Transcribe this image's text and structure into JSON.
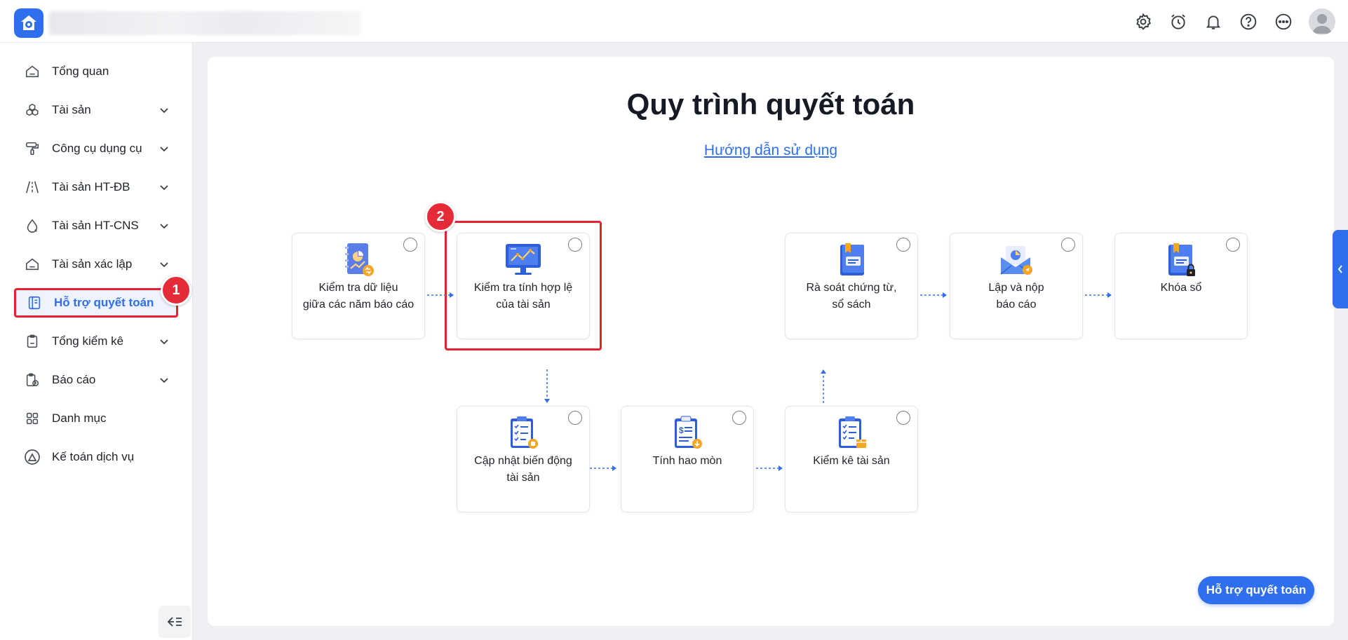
{
  "header": {
    "icons": [
      "settings-icon",
      "alarm-clock-icon",
      "bell-icon",
      "help-icon",
      "more-icon",
      "user-avatar"
    ]
  },
  "sidebar": {
    "items": [
      {
        "label": "Tổng quan",
        "icon": "home-icon",
        "has_children": false
      },
      {
        "label": "Tài sản",
        "icon": "cubes-icon",
        "has_children": true
      },
      {
        "label": "Công cụ dụng cụ",
        "icon": "paint-roller-icon",
        "has_children": true
      },
      {
        "label": "Tài sản HT-ĐB",
        "icon": "road-icon",
        "has_children": true
      },
      {
        "label": "Tài sản HT-CNS",
        "icon": "water-drop-icon",
        "has_children": true
      },
      {
        "label": "Tài sản xác lập",
        "icon": "home-icon",
        "has_children": true
      },
      {
        "label": "Hỗ trợ quyết toán",
        "icon": "book-icon",
        "has_children": false,
        "active": true
      },
      {
        "label": "Tổng kiểm kê",
        "icon": "clipboard-icon",
        "has_children": true
      },
      {
        "label": "Báo cáo",
        "icon": "report-icon",
        "has_children": true
      },
      {
        "label": "Danh mục",
        "icon": "grid-icon",
        "has_children": false
      },
      {
        "label": "Kế toán dịch vụ",
        "icon": "triangle-logo-icon",
        "has_children": false
      }
    ]
  },
  "badges": {
    "one": "1",
    "two": "2"
  },
  "main": {
    "title": "Quy trình quyết toán",
    "guide_link": "Hướng dẫn sử dụng",
    "steps": [
      {
        "label": "Kiểm tra dữ liệu\ngiữa các năm báo cáo",
        "icon": "notebook-chart-icon"
      },
      {
        "label": "Kiểm tra tính hợp lệ\ncủa tài sản",
        "icon": "monitor-chart-icon"
      },
      {
        "label": "Rà soát chứng từ,\nsổ sách",
        "icon": "book-icon"
      },
      {
        "label": "Lập và nộp\nbáo cáo",
        "icon": "envelope-report-icon"
      },
      {
        "label": "Khóa sổ",
        "icon": "locked-book-icon"
      },
      {
        "label": "Cập nhật biến động\ntài sản",
        "icon": "checklist-icon"
      },
      {
        "label": "Tính hao mòn",
        "icon": "invoice-icon"
      },
      {
        "label": "Kiểm kê tài sản",
        "icon": "inventory-clipboard-icon"
      }
    ],
    "help_button": "Hỗ trợ quyết toán"
  },
  "colors": {
    "accent": "#2f6fed",
    "highlight": "#e8202f",
    "badge": "#e52b37"
  }
}
